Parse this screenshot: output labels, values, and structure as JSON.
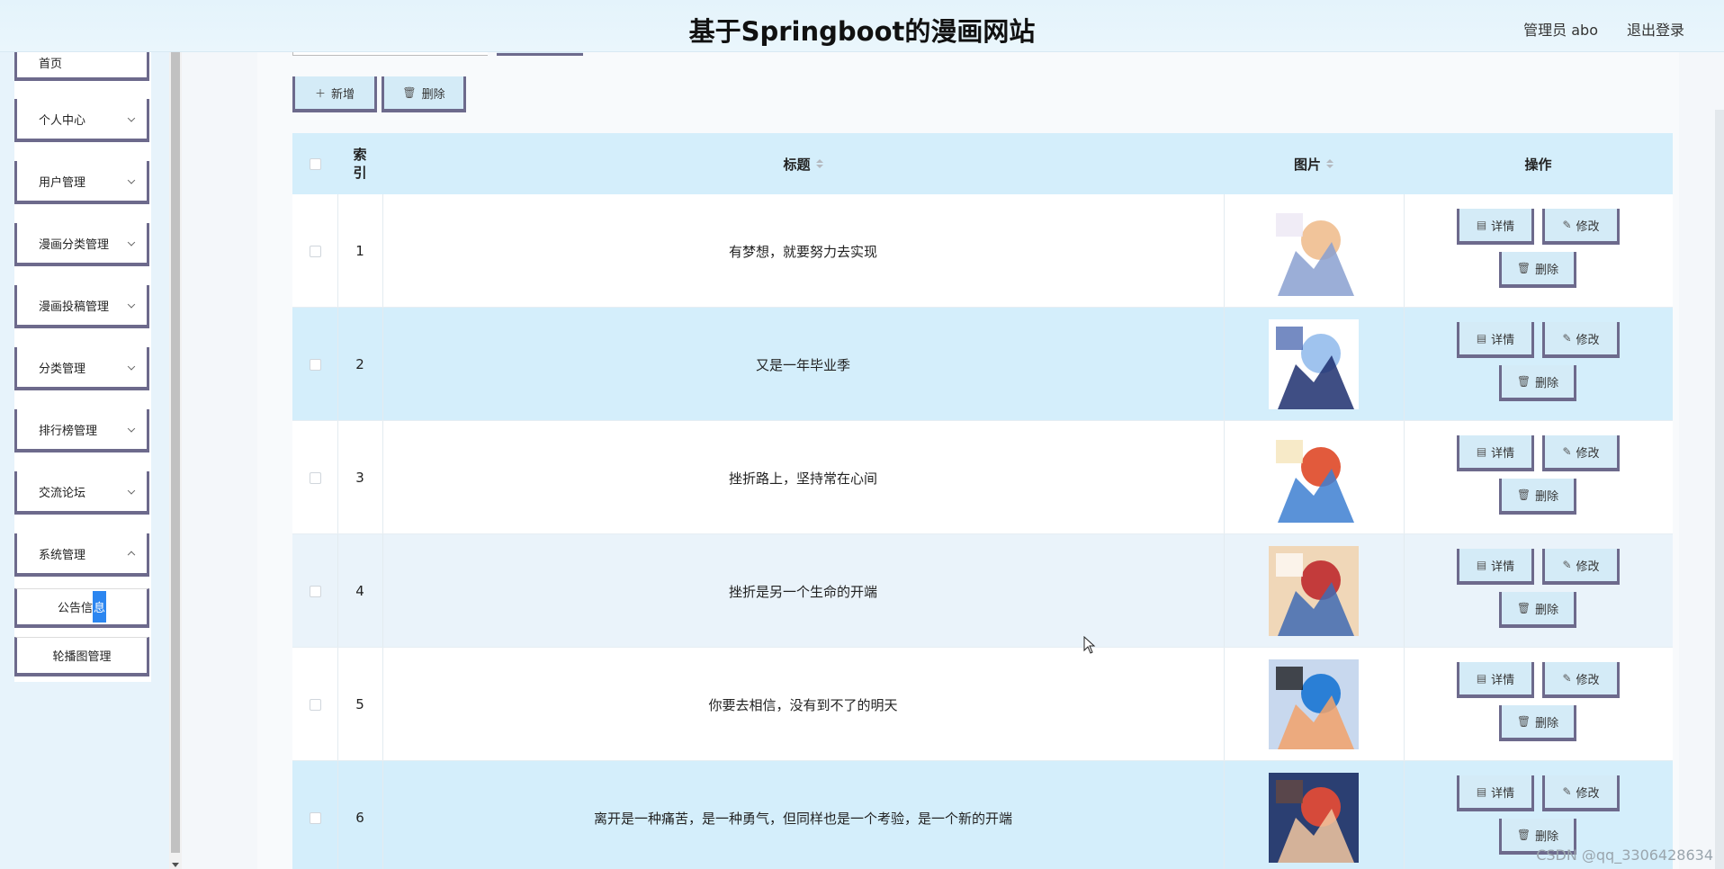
{
  "header": {
    "title": "基于Springboot的漫画网站",
    "user_label": "管理员 abo",
    "logout_label": "退出登录"
  },
  "sidebar": {
    "items": [
      {
        "label": "首页",
        "has_chevron": false
      },
      {
        "label": "个人中心",
        "has_chevron": true
      },
      {
        "label": "用户管理",
        "has_chevron": true
      },
      {
        "label": "漫画分类管理",
        "has_chevron": true
      },
      {
        "label": "漫画投稿管理",
        "has_chevron": true
      },
      {
        "label": "分类管理",
        "has_chevron": true
      },
      {
        "label": "排行榜管理",
        "has_chevron": true
      },
      {
        "label": "交流论坛",
        "has_chevron": true
      },
      {
        "label": "系统管理",
        "has_chevron": true
      }
    ],
    "subitems": [
      {
        "label_a": "公告信",
        "label_b": "息"
      },
      {
        "label": "轮播图管理"
      }
    ]
  },
  "toolbar": {
    "add_label": "新增",
    "delete_label": "删除"
  },
  "table": {
    "columns": {
      "index": "索\n引",
      "title": "标题",
      "image": "图片",
      "actions": "操作"
    },
    "rows": [
      {
        "index": "1",
        "title": "有梦想，就要努力去实现",
        "image": "anime-illustration-1"
      },
      {
        "index": "2",
        "title": "又是一年毕业季",
        "image": "anime-illustration-2"
      },
      {
        "index": "3",
        "title": "挫折路上，坚持常在心间",
        "image": "anime-illustration-3"
      },
      {
        "index": "4",
        "title": "挫折是另一个生命的开端",
        "image": "anime-illustration-4"
      },
      {
        "index": "5",
        "title": "你要去相信，没有到不了的明天",
        "image": "anime-illustration-5"
      },
      {
        "index": "6",
        "title": "离开是一种痛苦，是一种勇气，但同样也是一个考验，是一个新的开端",
        "image": "anime-illustration-6"
      }
    ],
    "row_actions": {
      "detail": "详情",
      "edit": "修改",
      "delete": "删除"
    }
  },
  "watermark": "CSDN @qq_3306428634",
  "colors": {
    "header_bg": "#e4f3fb",
    "table_header_bg": "#d4eefb",
    "button_bg": "#d4ebf7",
    "button_border": "#6d6a8c",
    "highlight": "#2c86f0"
  }
}
